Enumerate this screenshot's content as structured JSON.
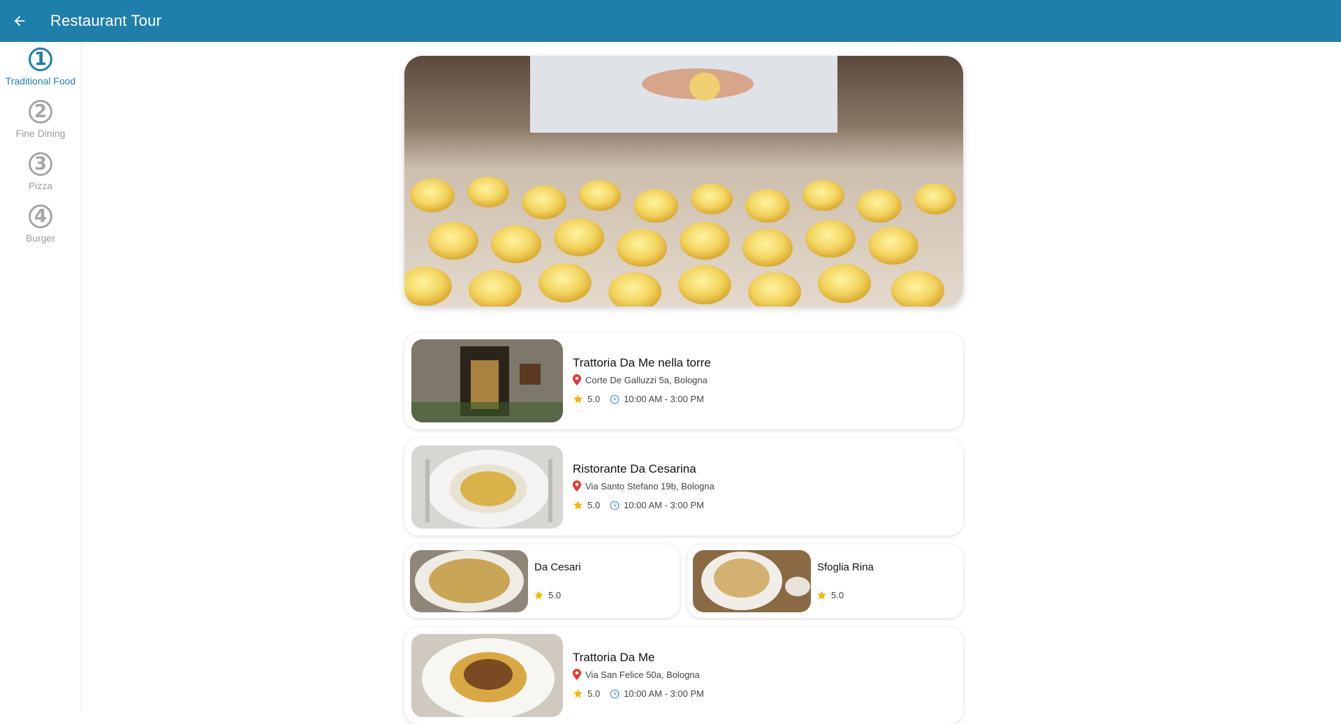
{
  "appbar": {
    "title": "Restaurant Tour",
    "back_icon": "arrow-left-icon",
    "color": "#1f7fab"
  },
  "steps": [
    {
      "number": "1",
      "label": "Traditional Food",
      "active": true
    },
    {
      "number": "2",
      "label": "Fine Dining",
      "active": false
    },
    {
      "number": "3",
      "label": "Pizza",
      "active": false
    },
    {
      "number": "4",
      "label": "Burger",
      "active": false
    }
  ],
  "hero": {
    "image": "fresh-tortellini-pasta-photo"
  },
  "restaurants": [
    {
      "name": "Trattoria Da Me nella torre",
      "address": "Corte De Galluzzi 5a, Bologna",
      "rating": "5.0",
      "hours": "10:00 AM - 3:00 PM"
    },
    {
      "name": "Ristorante Da Cesarina",
      "address": "Via Santo Stefano 19b, Bologna",
      "rating": "5.0",
      "hours": "10:00 AM - 3:00 PM"
    },
    {
      "name": "Da Cesari",
      "rating": "5.0"
    },
    {
      "name": "Sfoglia Rina",
      "rating": "5.0"
    },
    {
      "name": "Trattoria Da Me",
      "address": "Via San Felice 50a, Bologna",
      "rating": "5.0",
      "hours": "10:00 AM - 3:00 PM"
    }
  ],
  "colors": {
    "accent": "#1f7fab",
    "star": "#f5b800",
    "pin": "#e53935",
    "clock": "#4a90d9",
    "inactive": "#a6a6a6"
  }
}
